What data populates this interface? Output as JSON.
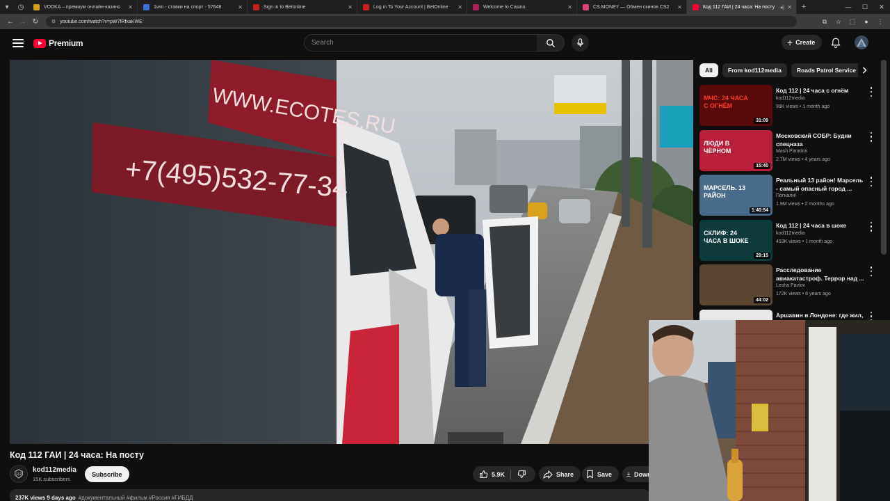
{
  "browser": {
    "tabs": [
      {
        "title": "VODKA – премиум онлайн-казино",
        "color": "#d4a017"
      },
      {
        "title": "1win - ставки на спорт - 57648",
        "color": "#3a6fd8"
      },
      {
        "title": "Sign in to Betonline",
        "color": "#c81e1e"
      },
      {
        "title": "Log in To Your Account | BetOnline",
        "color": "#c81e1e"
      },
      {
        "title": "Welcome to Casino.",
        "color": "#b01e5a"
      },
      {
        "title": "CS.MONEY — Обмен скинов CS2",
        "color": "#e0407a"
      },
      {
        "title": "Код 112 ГАИ | 24 часа: На посту",
        "color": "#ff0033"
      }
    ],
    "url": "youtube.com/watch?v=pW7fRfxaKWE"
  },
  "header": {
    "brand": "Premium",
    "search_placeholder": "Search",
    "create_label": "Create"
  },
  "video": {
    "title": "Код 112 ГАИ | 24 часа: На посту",
    "channel": "kod112media",
    "subscribers": "15K subscribers",
    "subscribe_label": "Subscribe",
    "likes": "5.9K",
    "share_label": "Share",
    "save_label": "Save",
    "download_label": "Download",
    "desc_views": "237K views  9 days ago",
    "desc_tags": "#документальный #фильм #Россия #ГИБДД",
    "scene_text": {
      "website": "WWW.ECOTES.RU",
      "phone": "+7(495)532-77-34"
    }
  },
  "sidebar": {
    "chips": [
      "All",
      "From kod112media",
      "Roads Patrol Service"
    ],
    "recommendations": [
      {
        "title": "Код 112 | 24 часа с огнём",
        "channel": "kod112media",
        "meta": "99K views • 1 month ago",
        "duration": "31:09",
        "thumb_text": "МЧС: 24 ЧАСА С ОГНЁМ",
        "bg": "#5a0a0a",
        "accent": "#ff3b1f"
      },
      {
        "title": "Московский СОБР: Будни спецназа",
        "channel": "Mash Paradox",
        "meta": "2.7M views • 4 years ago",
        "duration": "15:40",
        "thumb_text": "ЛЮДИ В ЧЁРНОМ",
        "bg": "#b81f3a",
        "accent": "#ffffff"
      },
      {
        "title": "Реальный 13 район! Марсель - самый опасный город ...",
        "channel": "Погнали!",
        "meta": "1.9M views • 2 months ago",
        "duration": "1:40:54",
        "thumb_text": "МАРСЕЛЬ. 13 РАЙОН",
        "bg": "#4a6a8a",
        "accent": "#ffffff"
      },
      {
        "title": "Код 112 | 24 часа в шоке",
        "channel": "kod112media",
        "meta": "453K views • 1 month ago",
        "duration": "29:15",
        "thumb_text": "СКЛИФ: 24 ЧАСА В ШОКЕ",
        "bg": "#0d3b3b",
        "accent": "#ffffff"
      },
      {
        "title": "Расследование авиакатастроф. Террор над ...",
        "channel": "Lesha Pavlov",
        "meta": "172K views • 8 years ago",
        "duration": "44:02",
        "thumb_text": "",
        "bg": "#5b4533",
        "accent": "#d8b48a"
      },
      {
        "title": "Аршавин в Лондоне: где жил, ...",
        "channel": "",
        "meta": "",
        "duration": "",
        "thumb_text": "",
        "bg": "#e8e8e8",
        "accent": "#333333"
      }
    ]
  }
}
